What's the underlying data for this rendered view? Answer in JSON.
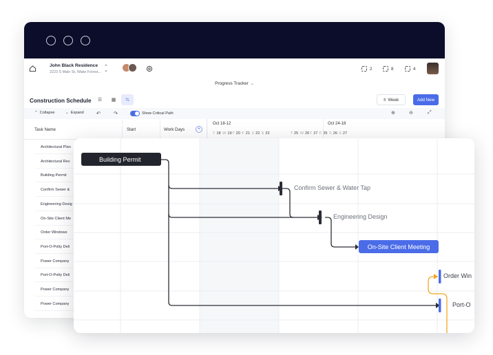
{
  "header": {
    "project_name": "John Black Residence",
    "project_address": "2223 S Main St, Wake Forest...",
    "counter_1": "2",
    "counter_2": "8",
    "counter_3": "4",
    "tracker_label": "Progress Tracker"
  },
  "toolbar": {
    "title": "Construction Schedule",
    "week_label": "Week",
    "add_label": "Add New",
    "collapse_label": "Collapse",
    "expand_label": "Expand",
    "critical_path_label": "Show Critical Path",
    "critical_path_on": true
  },
  "grid": {
    "col_task": "Task Name",
    "col_start": "Start",
    "col_days": "Work Days",
    "week_1": "Oct 18-12",
    "week_2": "Oct 24-18",
    "days": [
      {
        "d": "T",
        "n": "18"
      },
      {
        "d": "W",
        "n": "19"
      },
      {
        "d": "T",
        "n": "20"
      },
      {
        "d": "F",
        "n": "21"
      },
      {
        "d": "S",
        "n": "22"
      },
      {
        "d": "S",
        "n": "23"
      },
      {
        "d": "T",
        "n": "25"
      },
      {
        "d": "W",
        "n": "26"
      },
      {
        "d": "T",
        "n": "27"
      },
      {
        "d": "F",
        "n": "25"
      },
      {
        "d": "S",
        "n": "26"
      },
      {
        "d": "S",
        "n": "27"
      }
    ],
    "tasks": [
      "Architectural Plan",
      "Architectural Rev",
      "Building Permit",
      "Confirm Sewer & ",
      "Engineering Desig",
      "On-Site Client Me",
      "Order Windows",
      "Port-O-Potty Deli",
      "Power Company ",
      "Port-O-Potty Deli",
      "Power Company ",
      "Power Company "
    ]
  },
  "gantt": {
    "building_permit": "Building Permit",
    "confirm_sewer": "Confirm Sewer & Water Tap",
    "engineering_design": "Engineering Design",
    "onsite_meeting": "On-Site Client Meeting",
    "order_windows": "Order Win",
    "port_o": "Port-O"
  },
  "colors": {
    "accent": "#4b6ce8",
    "titlebar": "#0b0d2a",
    "dark_bar": "#23252e",
    "orange_link": "#f2a623"
  }
}
